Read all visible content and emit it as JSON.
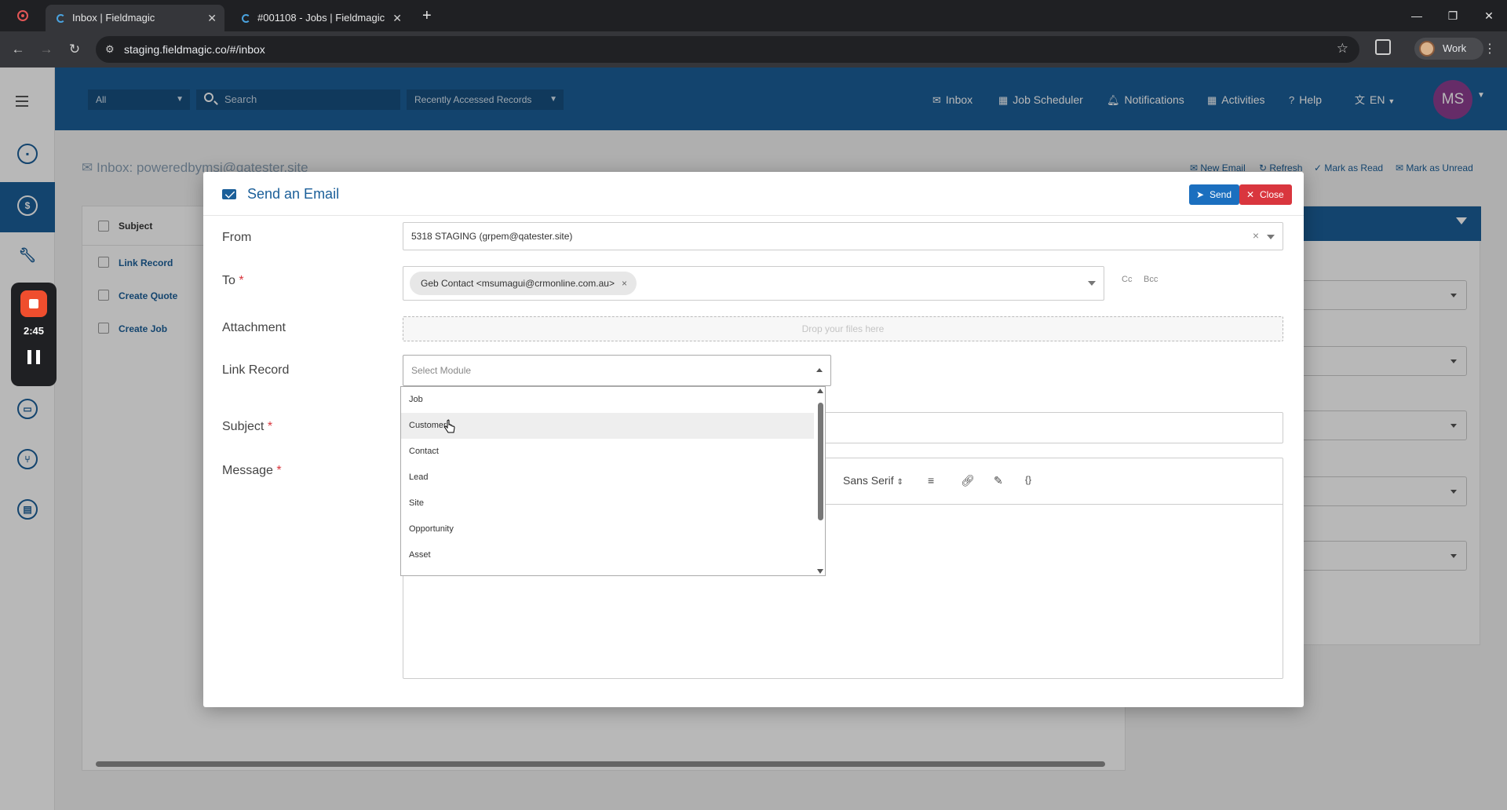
{
  "browser": {
    "tabs": [
      {
        "title": "Inbox | Fieldmagic"
      },
      {
        "title": "#001108 - Jobs | Fieldmagic"
      }
    ],
    "url": "staging.fieldmagic.co/#/inbox",
    "profile": "Work"
  },
  "recorder": {
    "time": "2:45"
  },
  "topbar": {
    "scope": "All",
    "search_placeholder": "Search",
    "recent": "Recently Accessed Records",
    "nav": [
      "Inbox",
      "Job Scheduler",
      "Notifications",
      "Activities",
      "Help",
      "EN"
    ],
    "avatar": "MS"
  },
  "inbox": {
    "title": "Inbox: poweredbymsi@qatester.site",
    "actions": [
      "New Email",
      "Refresh",
      "Mark as Read",
      "Mark as Unread"
    ],
    "column": "Subject",
    "rows": [
      "Link Record",
      "Create Quote",
      "Create Job"
    ]
  },
  "modal": {
    "title": "Send an Email",
    "send": "Send",
    "close": "Close",
    "labels": {
      "from": "From",
      "to": "To",
      "attachment": "Attachment",
      "link_record": "Link Record",
      "subject": "Subject",
      "message": "Message"
    },
    "required_mark": "*",
    "from_value": "5318 STAGING (grpem@qatester.site)",
    "to_chip": "Geb Contact <msumagui@crmonline.com.au>",
    "cc": "Cc",
    "bcc": "Bcc",
    "dropzone": "Drop your files here",
    "select_module_placeholder": "Select Module",
    "module_options": [
      "Job",
      "Customer",
      "Contact",
      "Lead",
      "Site",
      "Opportunity",
      "Asset"
    ],
    "highlighted_option": "Customer",
    "editor": {
      "font": "Sans Serif"
    }
  }
}
